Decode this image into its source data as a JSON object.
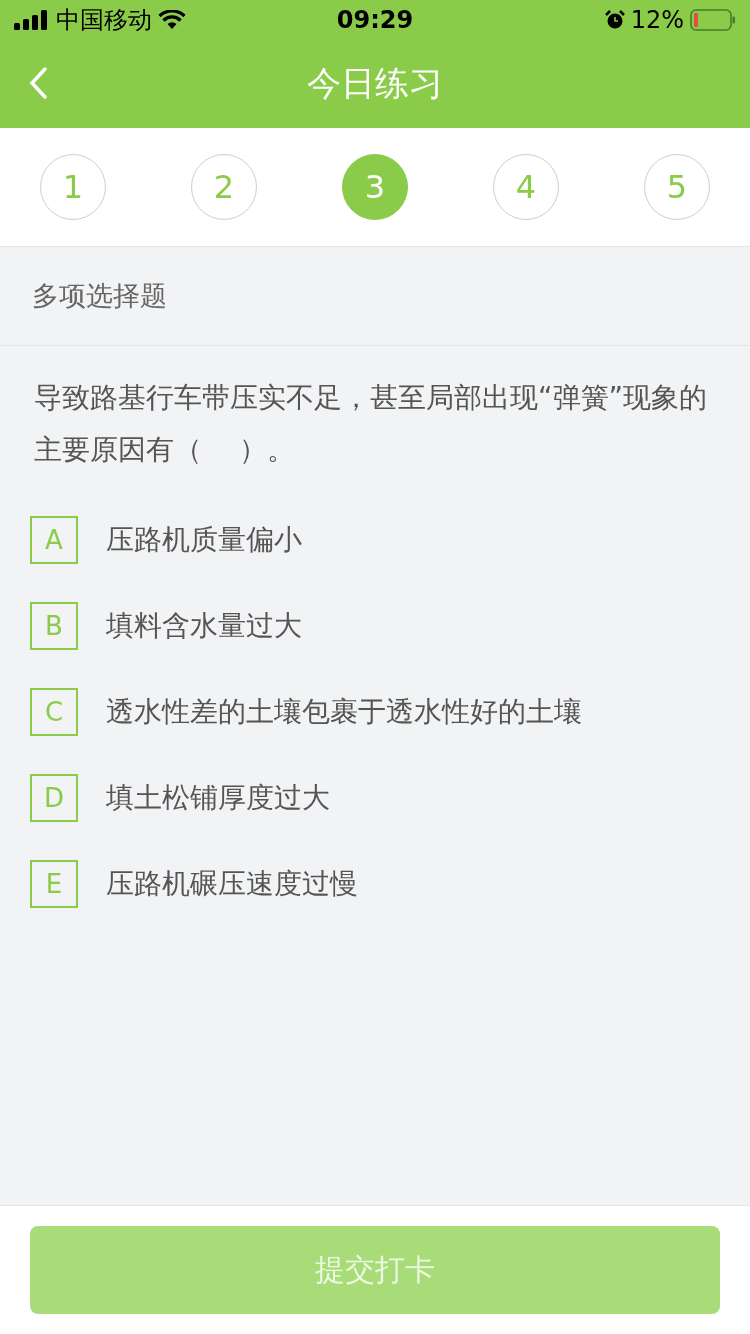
{
  "status_bar": {
    "carrier": "中国移动",
    "time": "09:29",
    "battery": "12%"
  },
  "nav": {
    "title": "今日练习"
  },
  "steps": [
    {
      "label": "1",
      "selected": false
    },
    {
      "label": "2",
      "selected": false
    },
    {
      "label": "3",
      "selected": true
    },
    {
      "label": "4",
      "selected": false
    },
    {
      "label": "5",
      "selected": false
    }
  ],
  "question": {
    "type": "多项选择题",
    "text": "导致路基行车带压实不足，甚至局部出现“弹簧”现象的主要原因有（　 ）。"
  },
  "options": [
    {
      "letter": "A",
      "text": "压路机质量偏小",
      "selected": false
    },
    {
      "letter": "B",
      "text": "填料含水量过大",
      "selected": false
    },
    {
      "letter": "C",
      "text": "透水性差的土壤包裹于透水性好的土壤",
      "selected": false
    },
    {
      "letter": "D",
      "text": "填土松铺厚度过大",
      "selected": false
    },
    {
      "letter": "E",
      "text": "压路机碾压速度过慢",
      "selected": false
    }
  ],
  "submit_button": {
    "label": "提交打卡",
    "disabled": true
  }
}
